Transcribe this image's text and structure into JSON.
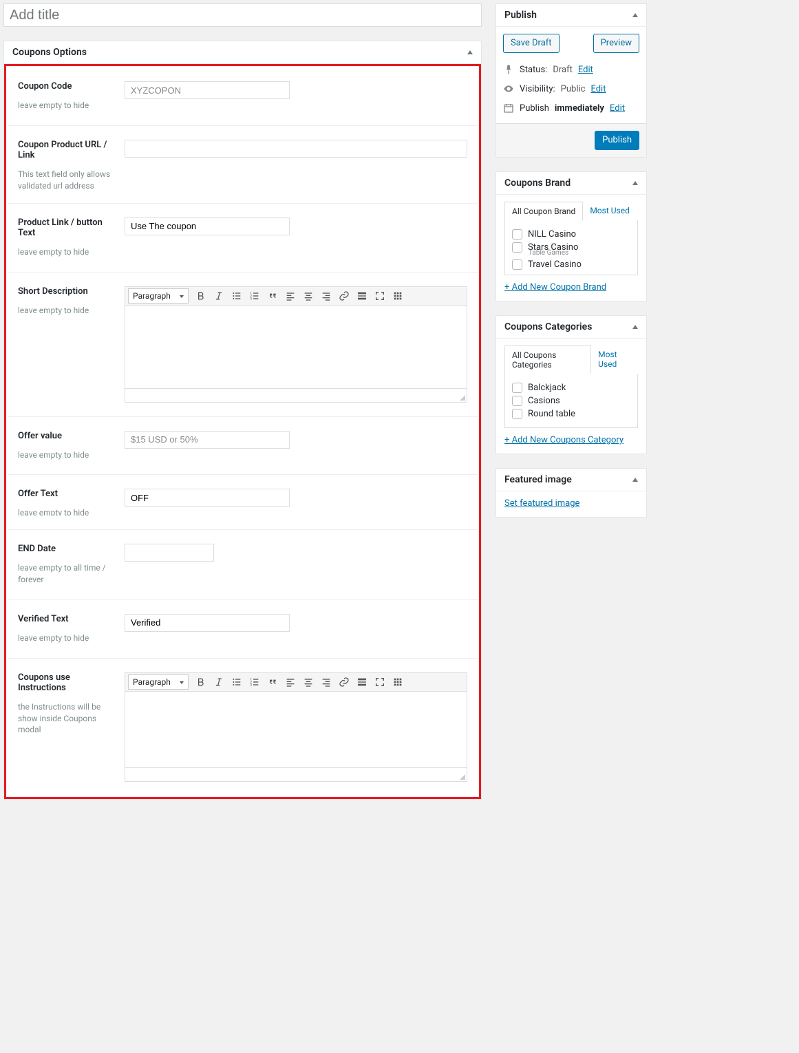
{
  "title": {
    "placeholder": "Add title",
    "value": ""
  },
  "options_box": {
    "header": "Coupons Options",
    "rows": {
      "coupon_code": {
        "label": "Coupon Code",
        "hint": "leave empty to hide",
        "placeholder": "XYZCOPON",
        "value": ""
      },
      "product_url": {
        "label": "Coupon Product URL / Link",
        "hint": "This text field only allows validated url address",
        "value": ""
      },
      "button_text": {
        "label": "Product Link / button Text",
        "hint": "leave empty to hide",
        "value": "Use The coupon"
      },
      "short_desc": {
        "label": "Short Description",
        "hint": "leave empty to hide"
      },
      "offer_value": {
        "label": "Offer value",
        "hint": "leave empty to hide",
        "placeholder": "$15 USD or 50%",
        "value": ""
      },
      "offer_text": {
        "label": "Offer Text",
        "hint": "leave empty to hide",
        "value": "OFF"
      },
      "end_date": {
        "label": "END Date",
        "hint": "leave empty to all time / forever",
        "value": ""
      },
      "verified_text": {
        "label": "Verified Text",
        "hint": "leave empty to hide",
        "value": "Verified"
      },
      "instructions": {
        "label": "Coupons use Instructions",
        "hint": "the Instructions will be show inside Coupons modal"
      }
    },
    "editor_format": "Paragraph"
  },
  "publish": {
    "header": "Publish",
    "save_draft": "Save Draft",
    "preview": "Preview",
    "status_label": "Status:",
    "status_value": "Draft",
    "visibility_label": "Visibility:",
    "visibility_value": "Public",
    "schedule_label": "Publish",
    "schedule_value": "immediately",
    "edit": "Edit",
    "publish_btn": "Publish"
  },
  "brand": {
    "header": "Coupons Brand",
    "tabs": {
      "all": "All Coupon Brand",
      "most": "Most Used"
    },
    "items": [
      "NILL Casino",
      "Stars Casino",
      "Travel Casino"
    ],
    "overflow_item": "Table Games",
    "add_new": "+ Add New Coupon Brand"
  },
  "categories": {
    "header": "Coupons Categories",
    "tabs": {
      "all": "All Coupons Categories",
      "most": "Most Used"
    },
    "items": [
      "Balckjack",
      "Casions",
      "Round table"
    ],
    "add_new": "+ Add New Coupons Category"
  },
  "featured": {
    "header": "Featured image",
    "link": "Set featured image"
  }
}
